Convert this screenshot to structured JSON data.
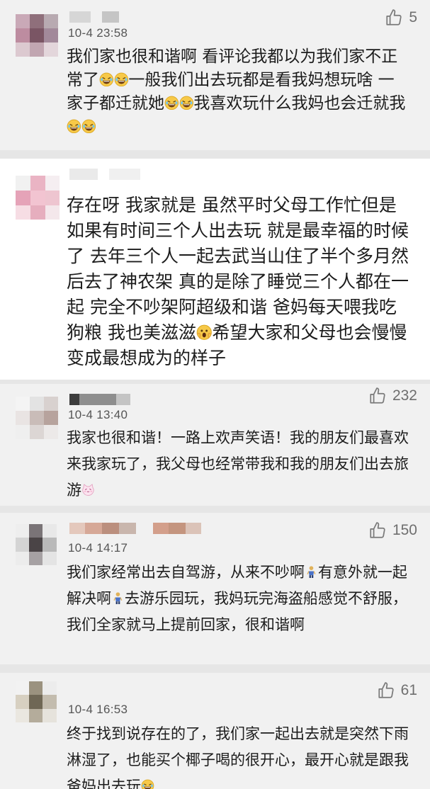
{
  "comments": [
    {
      "time": "10-4 23:58",
      "likes": "5",
      "segments": [
        {
          "t": "我们家也很和谐啊 看评论我都以为我们家不正常了"
        },
        {
          "e": "laughing-tears-icon"
        },
        {
          "e": "laughing-tears-icon"
        },
        {
          "t": "一般我们出去玩都是看我妈想玩啥 一家子都迁就她"
        },
        {
          "e": "laughing-tears-icon"
        },
        {
          "e": "laughing-tears-icon"
        },
        {
          "t": "我喜欢玩什么我妈也会迁就我"
        },
        {
          "e": "laughing-tears-icon"
        },
        {
          "e": "laughing-tears-icon"
        }
      ]
    },
    {
      "time": "",
      "likes": "",
      "segments": [
        {
          "t": "存在呀 我家就是 虽然平时父母工作忙但是如果有时间三个人出去玩 就是最幸福的时候了 去年三个人一起去武当山住了半个多月然后去了神农架 真的是除了睡觉三个人都在一起 完全不吵架阿超级和谐 爸妈每天喂我吃狗粮 我也美滋滋"
        },
        {
          "e": "scream-face-icon"
        },
        {
          "t": "希望大家和父母也会慢慢变成最想成为的样子"
        }
      ]
    },
    {
      "time": "10-4 13:40",
      "likes": "232",
      "segments": [
        {
          "t": "我家也很和谐！一路上欢声笑语！我的朋友们最喜欢来我家玩了，我父母也经常带我和我的朋友们出去旅游"
        },
        {
          "e": "cat-face-icon"
        }
      ]
    },
    {
      "time": "10-4 14:17",
      "likes": "150",
      "segments": [
        {
          "t": "我们家经常出去自驾游，从来不吵啊"
        },
        {
          "e": "person-icon"
        },
        {
          "t": "有意外就一起解决啊"
        },
        {
          "e": "person-icon"
        },
        {
          "t": "去游乐园玩，我妈玩完海盗船感觉不舒服，我们全家就马上提前回家，很和谐啊"
        }
      ]
    },
    {
      "time": "10-4 16:53",
      "likes": "61",
      "segments": [
        {
          "t": "终于找到说存在的了，我们家一起出去就是突然下雨淋湿了，也能买个椰子喝的很开心，最开心就是跟我爸妈出去玩"
        },
        {
          "e": "laughing-tears-icon"
        }
      ]
    }
  ],
  "colors": {
    "background": "#f1f1f1",
    "highlighted_card": "#ffffff",
    "separator": "#e6e6e6",
    "text": "#1c1c1c",
    "meta": "#555555"
  }
}
